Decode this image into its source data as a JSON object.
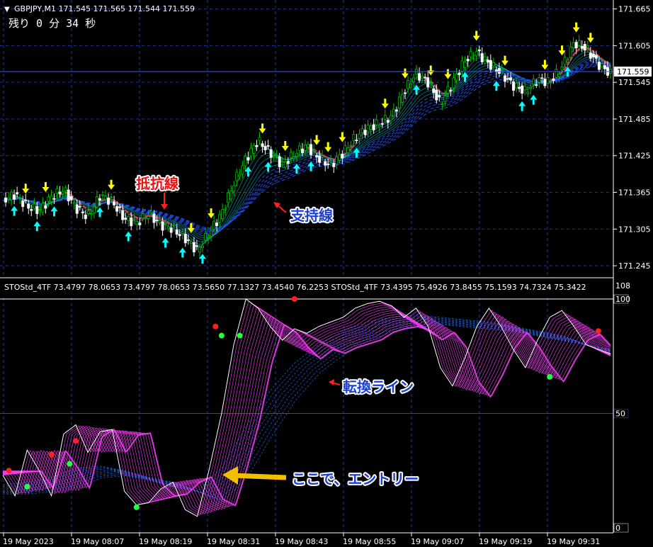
{
  "header": {
    "symbol_line": "GBPJPY,M1  171.545 171.565 171.544 171.559",
    "timer": "残り 0 分 34 秒"
  },
  "sub_header": {
    "text": "STOStd_4TF 73.4797 78.0653 73.4797 78.0653 73.5650 77.1327 73.4540 76.2253  STOStd_4TF 73.4395 75.4926 73.8455 75.1593 74.7324 75.3422"
  },
  "colors": {
    "background": "#000000",
    "grid": "#1a3aa0",
    "bull_candle": "#00c000",
    "bear_candle": "#ffffff",
    "ribbon_up": "#00e0ff",
    "ribbon_down": "#ff3030",
    "support_line": "#2050ff",
    "stoch_fast": "#ffffff",
    "stoch_ribbon": "#ff40ff",
    "stoch_slow": "#1e6fff",
    "arrow_up": "#00ffff",
    "arrow_down": "#ffff00",
    "dot_red": "#ff2020",
    "dot_green": "#20ff40"
  },
  "annotations": {
    "resistance": "抵抗線",
    "support": "支持線",
    "switch_line": "転換ライン",
    "entry": "ここで、エントリー"
  },
  "chart_data": [
    {
      "type": "candlestick",
      "symbol": "GBPJPY",
      "timeframe": "M1",
      "title": "GBPJPY,M1",
      "y_ticks": [
        "171.665",
        "171.605",
        "171.545",
        "171.485",
        "171.425",
        "171.365",
        "171.305",
        "171.245"
      ],
      "ylim": [
        171.23,
        171.675
      ],
      "current_price": "171.559",
      "current_price_value": 171.559,
      "x_ticks": [
        "19 May 2023",
        "19 May 08:07",
        "19 May 08:19",
        "19 May 08:31",
        "19 May 08:43",
        "19 May 08:55",
        "19 May 09:07",
        "19 May 09:19",
        "19 May 09:31"
      ],
      "close_path": [
        [
          0,
          171.352
        ],
        [
          4,
          171.362
        ],
        [
          8,
          171.342
        ],
        [
          12,
          171.335
        ],
        [
          16,
          171.358
        ],
        [
          20,
          171.37
        ],
        [
          24,
          171.34
        ],
        [
          28,
          171.325
        ],
        [
          32,
          171.36
        ],
        [
          36,
          171.35
        ],
        [
          40,
          171.322
        ],
        [
          44,
          171.315
        ],
        [
          48,
          171.33
        ],
        [
          52,
          171.312
        ],
        [
          56,
          171.305
        ],
        [
          60,
          171.29
        ],
        [
          64,
          171.27
        ],
        [
          68,
          171.3
        ],
        [
          72,
          171.33
        ],
        [
          76,
          171.38
        ],
        [
          80,
          171.42
        ],
        [
          84,
          171.45
        ],
        [
          88,
          171.43
        ],
        [
          92,
          171.41
        ],
        [
          96,
          171.428
        ],
        [
          100,
          171.442
        ],
        [
          104,
          171.42
        ],
        [
          108,
          171.41
        ],
        [
          112,
          171.43
        ],
        [
          116,
          171.455
        ],
        [
          120,
          171.47
        ],
        [
          124,
          171.478
        ],
        [
          128,
          171.49
        ],
        [
          132,
          171.53
        ],
        [
          136,
          171.56
        ],
        [
          140,
          171.545
        ],
        [
          144,
          171.51
        ],
        [
          148,
          171.545
        ],
        [
          152,
          171.58
        ],
        [
          156,
          171.595
        ],
        [
          160,
          171.575
        ],
        [
          164,
          171.56
        ],
        [
          168,
          171.54
        ],
        [
          172,
          171.53
        ],
        [
          176,
          171.55
        ],
        [
          180,
          171.545
        ],
        [
          184,
          171.57
        ],
        [
          188,
          171.61
        ],
        [
          192,
          171.6
        ],
        [
          196,
          171.575
        ],
        [
          200,
          171.559
        ]
      ]
    },
    {
      "type": "line",
      "title": "STOStd_4TF",
      "y_ticks": [
        "100",
        "50",
        "0"
      ],
      "ylim": [
        0,
        108
      ],
      "levels": [
        100,
        50
      ],
      "series": [
        {
          "name": "STOStd_4TF",
          "values": [
            [
              0,
              23
            ],
            [
              4,
              14
            ],
            [
              8,
              34
            ],
            [
              12,
              25
            ],
            [
              16,
              14
            ],
            [
              20,
              41
            ],
            [
              24,
              45
            ],
            [
              28,
              33
            ],
            [
              32,
              42
            ],
            [
              36,
              43
            ],
            [
              40,
              16
            ],
            [
              44,
              10
            ],
            [
              48,
              11
            ],
            [
              52,
              17
            ],
            [
              56,
              20
            ],
            [
              60,
              8
            ],
            [
              64,
              5
            ],
            [
              68,
              26
            ],
            [
              72,
              50
            ],
            [
              76,
              80
            ],
            [
              80,
              100
            ],
            [
              84,
              96
            ],
            [
              88,
              88
            ],
            [
              92,
              82
            ],
            [
              96,
              87
            ],
            [
              100,
              85
            ],
            [
              104,
              88
            ],
            [
              108,
              90
            ],
            [
              112,
              92
            ],
            [
              116,
              96
            ],
            [
              120,
              98
            ],
            [
              124,
              99
            ],
            [
              128,
              97
            ],
            [
              132,
              92
            ],
            [
              136,
              96
            ],
            [
              140,
              88
            ],
            [
              144,
              70
            ],
            [
              148,
              62
            ],
            [
              152,
              74
            ],
            [
              156,
              88
            ],
            [
              160,
              96
            ],
            [
              164,
              88
            ],
            [
              168,
              78
            ],
            [
              172,
              70
            ],
            [
              176,
              82
            ],
            [
              180,
              92
            ],
            [
              184,
              95
            ],
            [
              188,
              88
            ],
            [
              192,
              80
            ],
            [
              196,
              78
            ],
            [
              200,
              76
            ]
          ]
        },
        {
          "name": "STOStd_4TF",
          "values": [
            [
              0,
              19
            ],
            [
              8,
              20
            ],
            [
              16,
              22
            ],
            [
              24,
              26
            ],
            [
              32,
              27
            ],
            [
              40,
              25
            ],
            [
              48,
              22
            ],
            [
              56,
              20
            ],
            [
              64,
              16
            ],
            [
              72,
              26
            ],
            [
              80,
              44
            ],
            [
              88,
              60
            ],
            [
              96,
              72
            ],
            [
              104,
              80
            ],
            [
              112,
              86
            ],
            [
              120,
              90
            ],
            [
              128,
              92
            ],
            [
              136,
              93
            ],
            [
              144,
              92
            ],
            [
              152,
              91
            ],
            [
              160,
              90
            ],
            [
              168,
              88
            ],
            [
              176,
              86
            ],
            [
              184,
              84
            ],
            [
              192,
              80
            ],
            [
              200,
              78
            ]
          ]
        }
      ],
      "signals": {
        "red": [
          [
            2,
            25
          ],
          [
            16,
            32
          ],
          [
            24,
            38
          ],
          [
            70,
            88
          ],
          [
            96,
            100
          ],
          [
            196,
            86
          ]
        ],
        "green": [
          [
            8,
            18
          ],
          [
            22,
            28
          ],
          [
            44,
            9
          ],
          [
            72,
            84
          ],
          [
            78,
            84
          ],
          [
            180,
            66
          ]
        ]
      }
    }
  ]
}
